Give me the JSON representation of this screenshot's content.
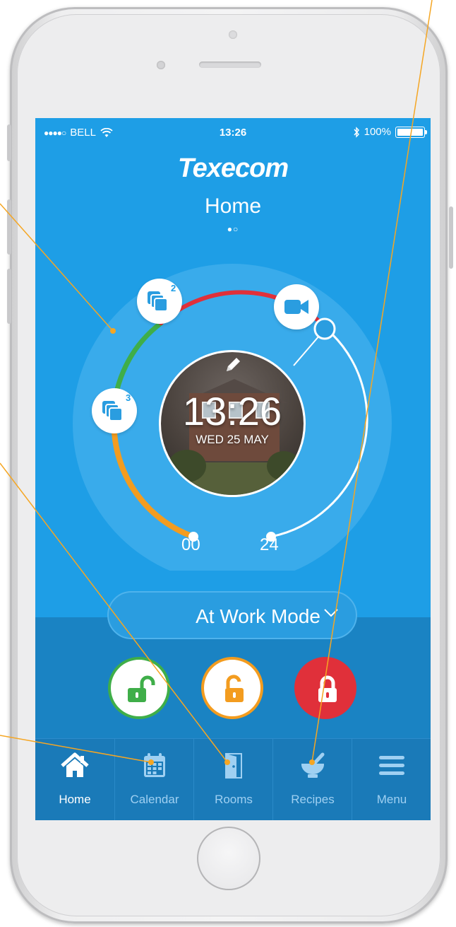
{
  "status_bar": {
    "carrier": "BELL",
    "signal": "●●●●○",
    "time": "13:26",
    "battery": "100%"
  },
  "header": {
    "logo": "Texecom",
    "title": "Home",
    "page_dots": "●○"
  },
  "dial": {
    "clock_time": "13:26",
    "clock_date": "WED 25 MAY",
    "start_label": "00",
    "end_label": "24",
    "events": [
      {
        "icon": "stacked-squares-icon",
        "count": "2"
      },
      {
        "icon": "stacked-squares-icon",
        "count": "3"
      },
      {
        "icon": "video-camera-icon"
      }
    ],
    "colors": {
      "green": "#3fae49",
      "red": "#e0303a",
      "orange": "#f39c1f"
    }
  },
  "mode": {
    "label": "At Work Mode"
  },
  "lock_buttons": [
    {
      "icon": "unlocked-padlock-icon",
      "color": "#3fae49"
    },
    {
      "icon": "unlocked-padlock-icon",
      "color": "#f39c1f"
    },
    {
      "icon": "locked-padlock-icon",
      "color": "#e0303a"
    }
  ],
  "tabs": [
    {
      "label": "Home",
      "icon": "house-icon",
      "active": true
    },
    {
      "label": "Calendar",
      "icon": "calendar-icon",
      "active": false
    },
    {
      "label": "Rooms",
      "icon": "door-icon",
      "active": false
    },
    {
      "label": "Recipes",
      "icon": "mortar-pestle-icon",
      "active": false
    },
    {
      "label": "Menu",
      "icon": "hamburger-menu-icon",
      "active": false
    }
  ],
  "accent_colors": {
    "screen_blue": "#1e9ee6",
    "panel_blue": "#1a83c3",
    "callout_line": "#f5a623"
  }
}
